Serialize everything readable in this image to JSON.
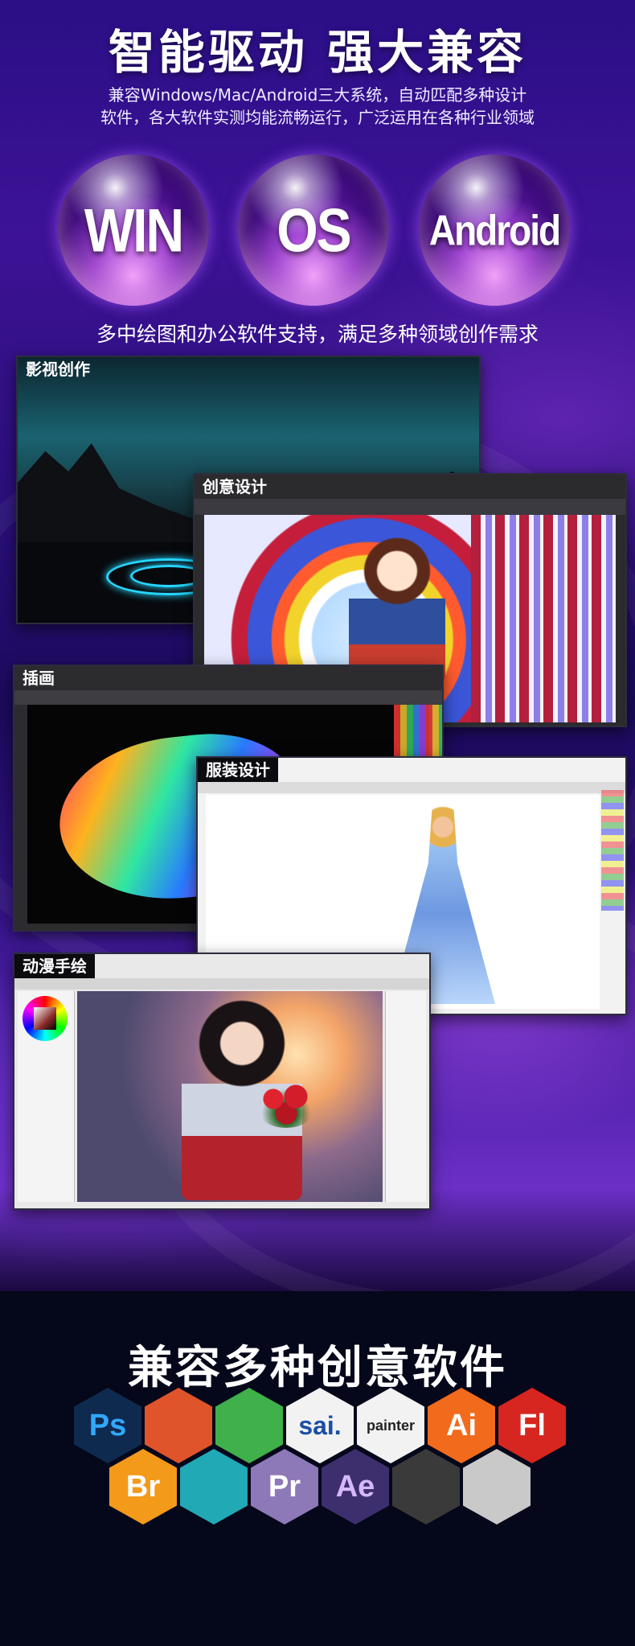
{
  "hero": {
    "title": "智能驱动  强大兼容",
    "subtitle_line1": "兼容Windows/Mac/Android三大系统，自动匹配多种设计",
    "subtitle_line2": "软件，各大软件实测均能流畅运行，广泛运用在各种行业领域"
  },
  "os": [
    {
      "label": "WIN"
    },
    {
      "label": "OS"
    },
    {
      "label": "Android"
    }
  ],
  "support_text": "多中绘图和办公软件支持，满足多种领域创作需求",
  "screens": [
    {
      "label": "影视创作"
    },
    {
      "label": "创意设计"
    },
    {
      "label": "插画"
    },
    {
      "label": "服装设计"
    },
    {
      "label": "动漫手绘"
    }
  ],
  "software_section": {
    "title": "兼容多种创意软件",
    "icons": [
      {
        "name": "photoshop-icon",
        "text": "Ps",
        "bg": "#0f2a4f",
        "fg": "#31a8ff"
      },
      {
        "name": "sketchbook-icon",
        "text": "",
        "bg": "#e0542b",
        "fg": "#ffffff"
      },
      {
        "name": "corel-draw-icon",
        "text": "",
        "bg": "#3fb04a",
        "fg": "#ffffff"
      },
      {
        "name": "sai-icon",
        "text": "sai.",
        "bg": "#f2f2f2",
        "fg": "#1a4fa3"
      },
      {
        "name": "painter-icon",
        "text": "painter",
        "bg": "#f2f2f2",
        "fg": "#222222"
      },
      {
        "name": "illustrator-icon",
        "text": "Ai",
        "bg": "#f26b1d",
        "fg": "#ffffff"
      },
      {
        "name": "flash-icon",
        "text": "Fl",
        "bg": "#d7261f",
        "fg": "#ffffff"
      },
      {
        "name": "bridge-icon",
        "text": "Br",
        "bg": "#f39a1a",
        "fg": "#ffffff"
      },
      {
        "name": "maya-icon",
        "text": "",
        "bg": "#21a9b5",
        "fg": "#ffffff"
      },
      {
        "name": "premiere-icon",
        "text": "Pr",
        "bg": "#8e79b8",
        "fg": "#ffffff"
      },
      {
        "name": "after-effects-icon",
        "text": "Ae",
        "bg": "#3d2f6e",
        "fg": "#d6b8ff"
      },
      {
        "name": "3dsmax-icon",
        "text": "",
        "bg": "#3a3a3a",
        "fg": "#ffffff"
      },
      {
        "name": "zbrush-icon",
        "text": "",
        "bg": "#c9c9c9",
        "fg": "#111111"
      }
    ]
  }
}
